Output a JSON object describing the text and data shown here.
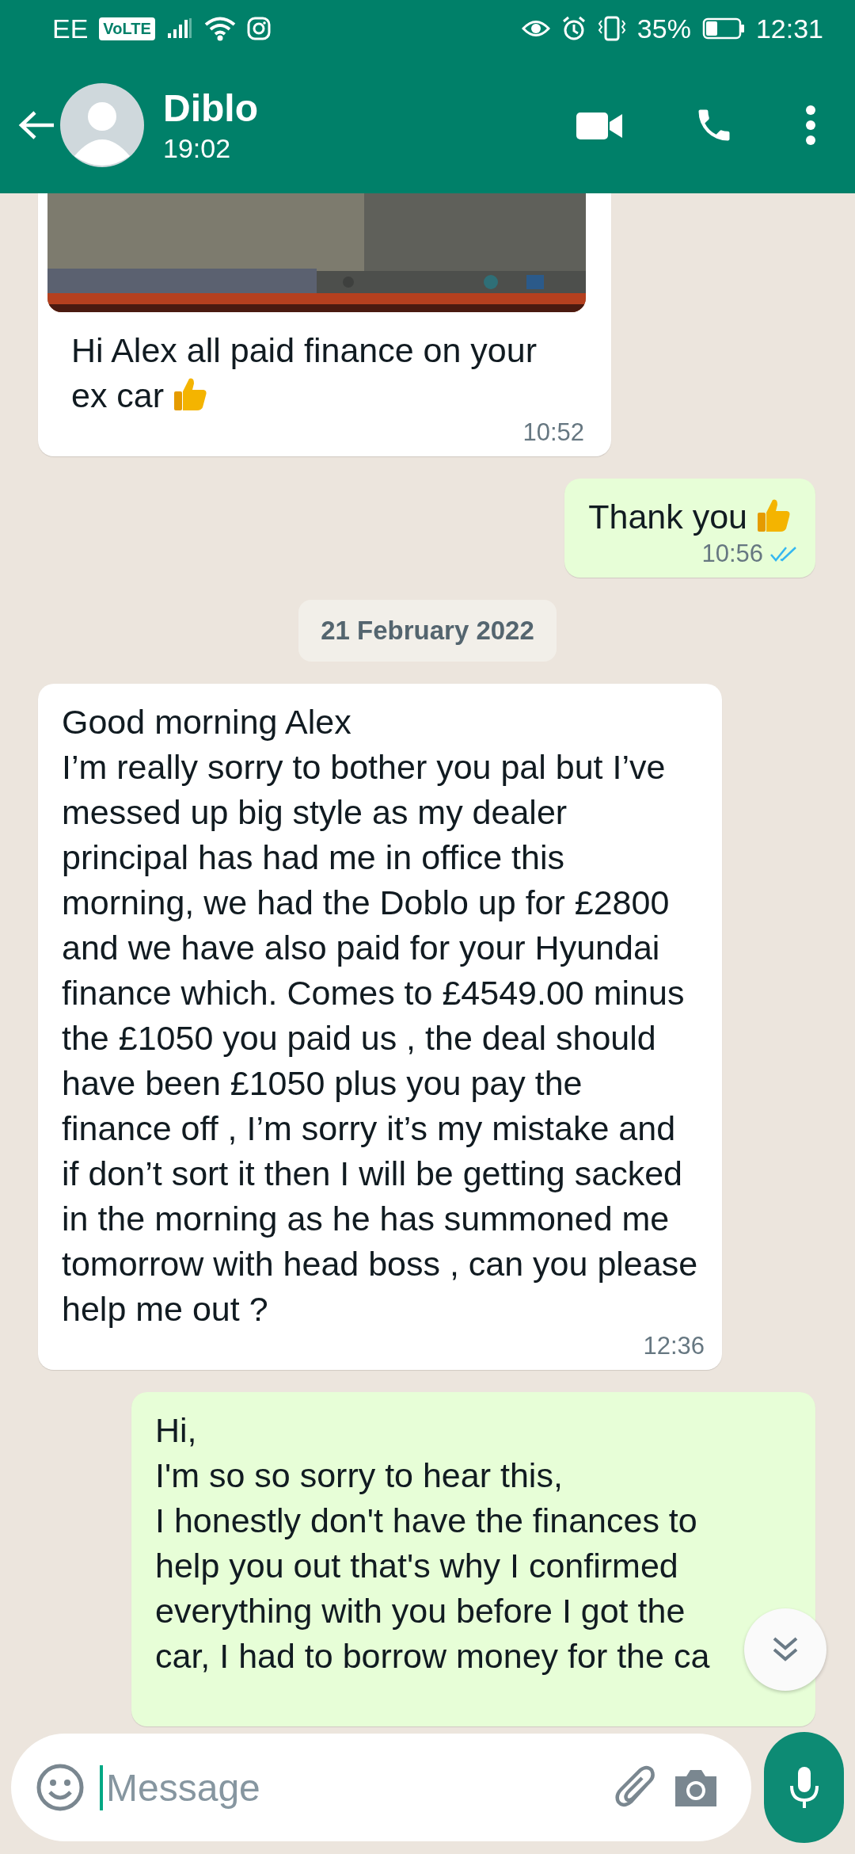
{
  "status_bar": {
    "carrier": "EE",
    "volte": "VoLTE",
    "battery": "35%",
    "time": "12:31"
  },
  "header": {
    "contact": "Diblo",
    "subtitle": "19:02"
  },
  "messages": [
    {
      "kind": "incoming_image",
      "text": "Hi Alex all paid finance on your ex car",
      "thumbs_up": true,
      "time": "10:52"
    },
    {
      "kind": "outgoing",
      "text": "Thank you",
      "thumbs_up": true,
      "time": "10:56",
      "read": true
    },
    {
      "kind": "date",
      "text": "21 February 2022"
    },
    {
      "kind": "incoming",
      "text": "Good morning Alex\nI’m really sorry to bother you pal but I’ve messed up big style as my dealer principal has had me in office this morning, we had the Doblo up for £2800 and we have also paid for your Hyundai finance which. Comes to £4549.00 minus the £1050 you paid us , the deal should have been £1050 plus you pay the finance off , I’m sorry it’s my mistake and if don’t sort it then I will be getting sacked in the morning as he has summoned me tomorrow with head boss , can you please help me out ?",
      "time": "12:36"
    },
    {
      "kind": "outgoing",
      "text": "Hi,\nI'm so so sorry to hear this,\nI honestly don't have the finances to help you out that's why I confirmed everything with you before I got the\ncar, I had to borrow money for the ca"
    }
  ],
  "composer": {
    "placeholder": "Message"
  }
}
